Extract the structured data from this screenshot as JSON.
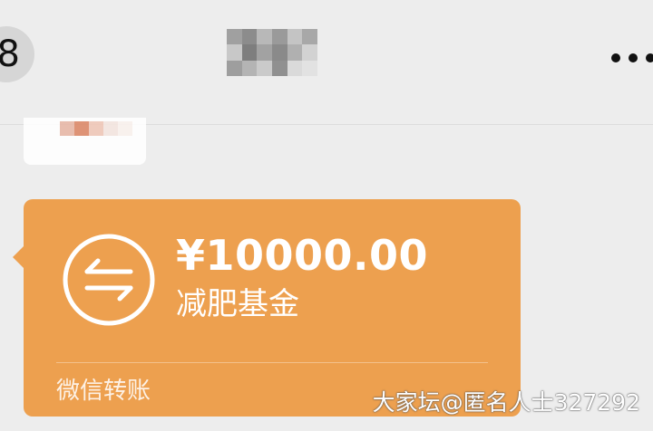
{
  "header": {
    "back_badge_text": "8",
    "title_pixelated": true,
    "more_icon": "more-dots-icon"
  },
  "previous_message": {
    "content_pixelated": true
  },
  "transfer": {
    "amount": "¥10000.00",
    "note": "减肥基金",
    "footer_label": "微信转账",
    "icon": "transfer-arrows-icon",
    "colors": {
      "card": "#eda04f",
      "text": "#ffffff"
    }
  },
  "watermark": {
    "text": "大家坛@匿名人士327292"
  }
}
